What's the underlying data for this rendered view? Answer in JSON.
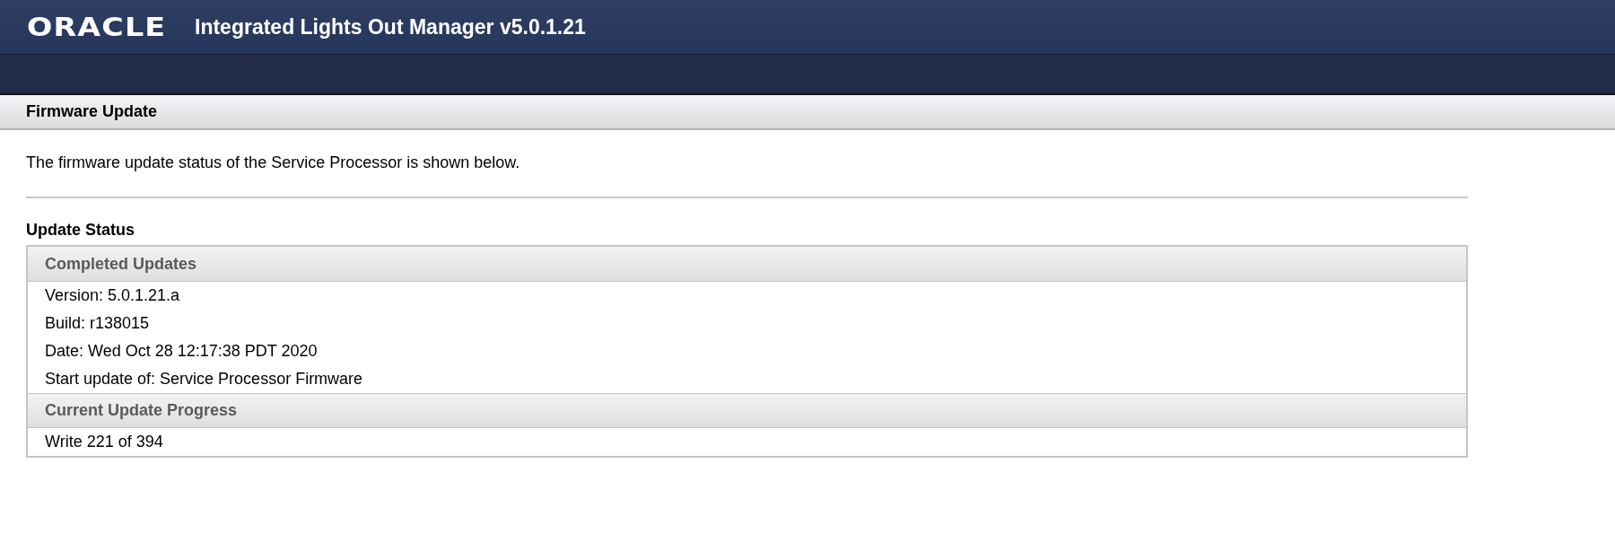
{
  "header": {
    "logo": "ORACLE",
    "title": "Integrated Lights Out Manager v5.0.1.21"
  },
  "page_title": "Firmware Update",
  "description": "The firmware update status of the Service Processor is shown below.",
  "status_heading": "Update Status",
  "sections": [
    {
      "title": "Completed Updates",
      "lines": [
        "Version: 5.0.1.21.a",
        "Build: r138015",
        "Date: Wed Oct 28 12:17:38 PDT 2020",
        "Start update of: Service Processor Firmware"
      ]
    },
    {
      "title": "Current Update Progress",
      "lines": [
        "Write 221 of 394"
      ]
    }
  ]
}
